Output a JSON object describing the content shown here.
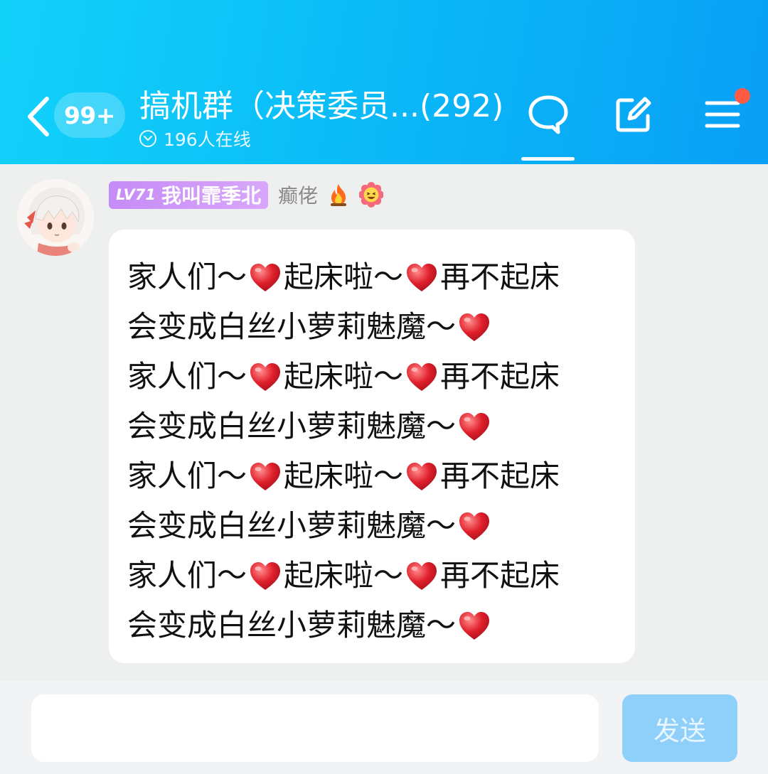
{
  "header": {
    "unread_count": "99+",
    "group_title": "搞机群（决策委员...(292)",
    "online_text": "196人在线",
    "accent_colors": [
      "#12d2fa",
      "#099ff6"
    ],
    "notification_dot_color": "#ff5b44"
  },
  "message": {
    "avatar_icon": "anime-avatar",
    "level": "LV71",
    "sender_name": "我叫霏季北",
    "member_title": "癫佬",
    "badges": [
      "fire-icon",
      "laughing-flower-icon"
    ],
    "lines": [
      {
        "parts": [
          "家人们～",
          "heart",
          "起床啦～",
          "heart",
          "再不起床"
        ]
      },
      {
        "parts": [
          "会变成白丝小萝莉魅魔～",
          "heart"
        ]
      },
      {
        "parts": [
          "家人们～",
          "heart",
          "起床啦～",
          "heart",
          "再不起床"
        ]
      },
      {
        "parts": [
          "会变成白丝小萝莉魅魔～",
          "heart"
        ]
      },
      {
        "parts": [
          "家人们～",
          "heart",
          "起床啦～",
          "heart",
          "再不起床"
        ]
      },
      {
        "parts": [
          "会变成白丝小萝莉魅魔～",
          "heart"
        ]
      },
      {
        "parts": [
          "家人们～",
          "heart",
          "起床啦～",
          "heart",
          "再不起床"
        ]
      },
      {
        "parts": [
          "会变成白丝小萝莉魅魔～",
          "heart"
        ]
      }
    ]
  },
  "input": {
    "value": "",
    "placeholder": "",
    "send_label": "发送"
  }
}
